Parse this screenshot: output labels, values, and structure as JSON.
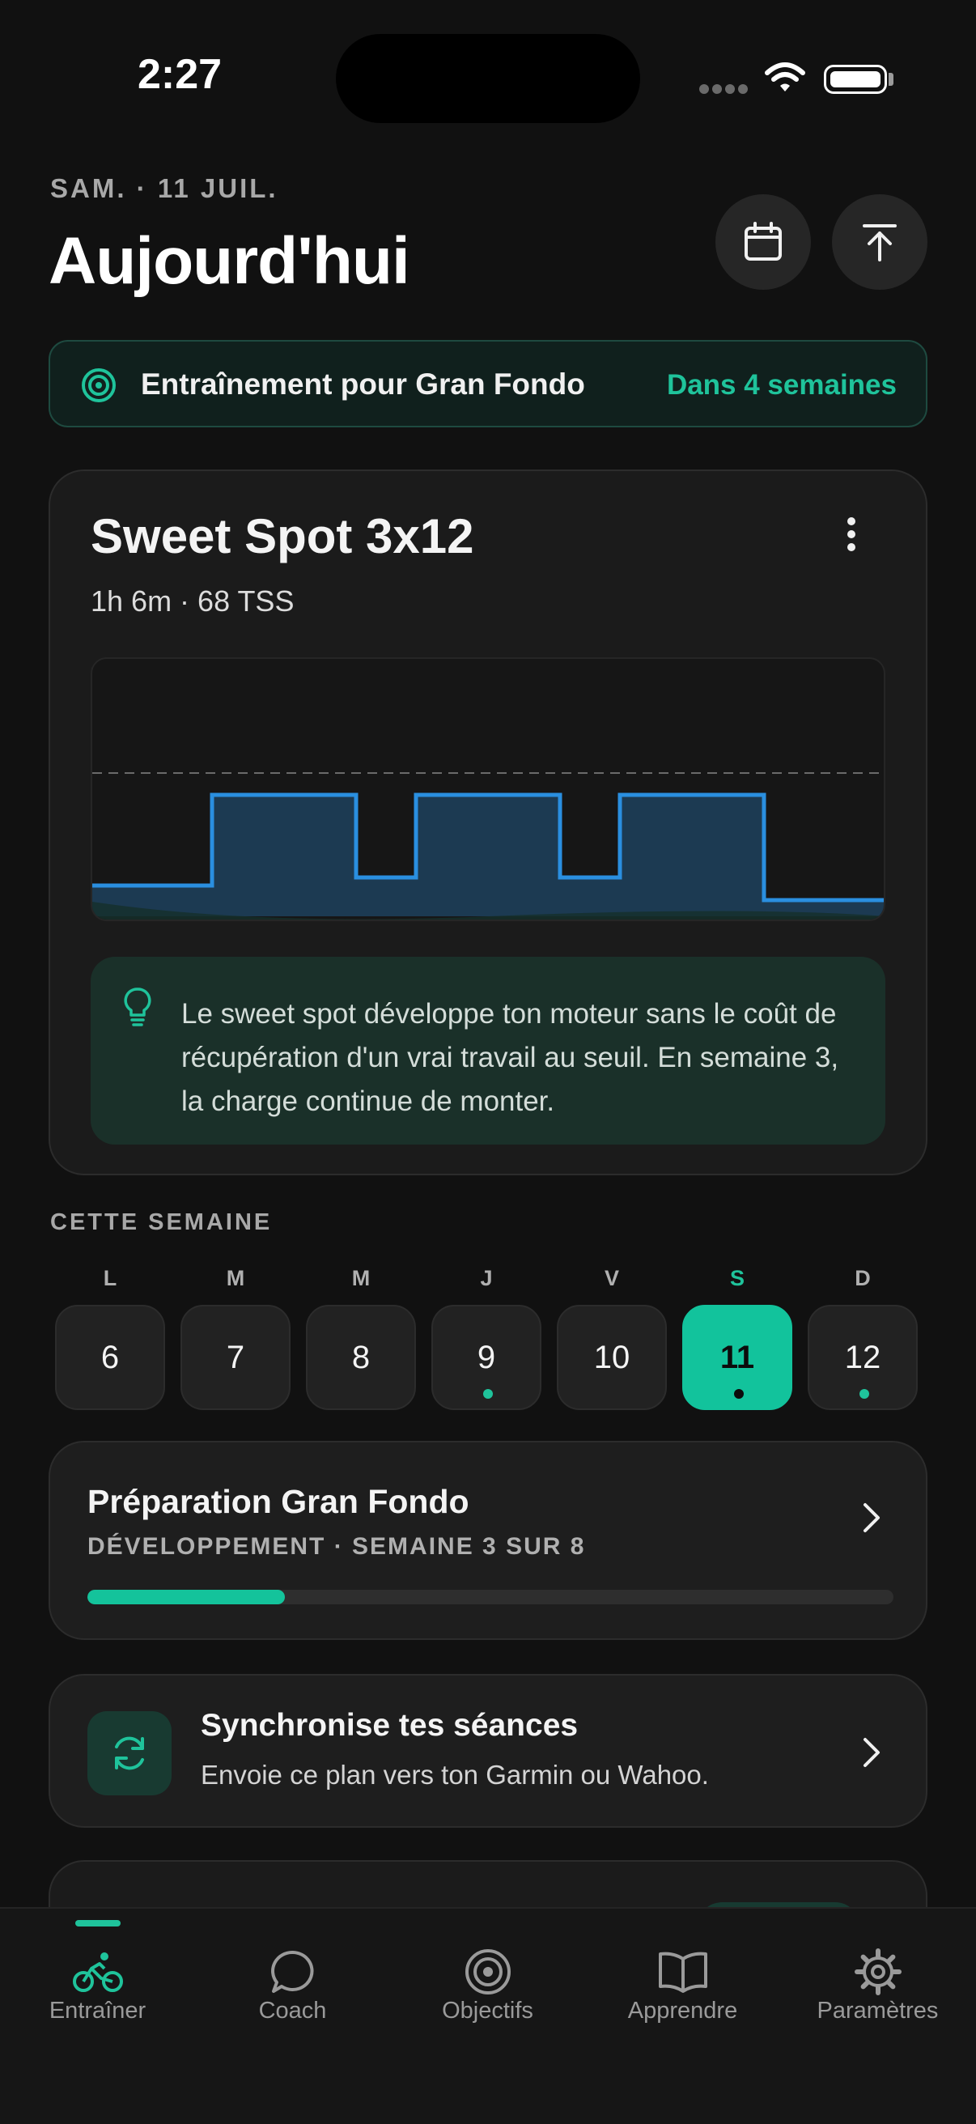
{
  "status_bar": {
    "time": "2:27"
  },
  "header": {
    "date": "SAM. · 11 JUIL.",
    "title": "Aujourd'hui"
  },
  "goal_banner": {
    "label": "Entraînement pour Gran Fondo",
    "eta": "Dans 4 semaines"
  },
  "workout": {
    "title": "Sweet Spot 3x12",
    "meta": "1h 6m · 68 TSS",
    "tip": "Le sweet spot développe ton moteur sans le coût de récupération d'un vrai travail au seuil. En semaine 3, la charge continue de monter."
  },
  "week": {
    "label": "CETTE SEMAINE",
    "days": [
      {
        "letter": "L",
        "number": "6",
        "dot": false,
        "active": false
      },
      {
        "letter": "M",
        "number": "7",
        "dot": false,
        "active": false
      },
      {
        "letter": "M",
        "number": "8",
        "dot": false,
        "active": false
      },
      {
        "letter": "J",
        "number": "9",
        "dot": true,
        "active": false
      },
      {
        "letter": "V",
        "number": "10",
        "dot": false,
        "active": false
      },
      {
        "letter": "S",
        "number": "11",
        "dot": true,
        "active": true
      },
      {
        "letter": "D",
        "number": "12",
        "dot": true,
        "active": false
      }
    ]
  },
  "plan": {
    "title": "Préparation Gran Fondo",
    "subtitle": "DÉVELOPPEMENT · SEMAINE 3 SUR 8",
    "progress": 0.245
  },
  "sync": {
    "title": "Synchronise tes séances",
    "subtitle": "Envoie ce plan vers ton Garmin ou Wahoo."
  },
  "tabs": [
    {
      "label": "Entraîner",
      "icon": "bike-icon",
      "active": true
    },
    {
      "label": "Coach",
      "icon": "chat-bubble-icon",
      "active": false
    },
    {
      "label": "Objectifs",
      "icon": "target-icon",
      "active": false
    },
    {
      "label": "Apprendre",
      "icon": "book-icon",
      "active": false
    },
    {
      "label": "Paramètres",
      "icon": "gear-icon",
      "active": false
    }
  ],
  "colors": {
    "accent": "#1fc39b",
    "workout_line": "#2a8fe0",
    "background": "#111111"
  }
}
